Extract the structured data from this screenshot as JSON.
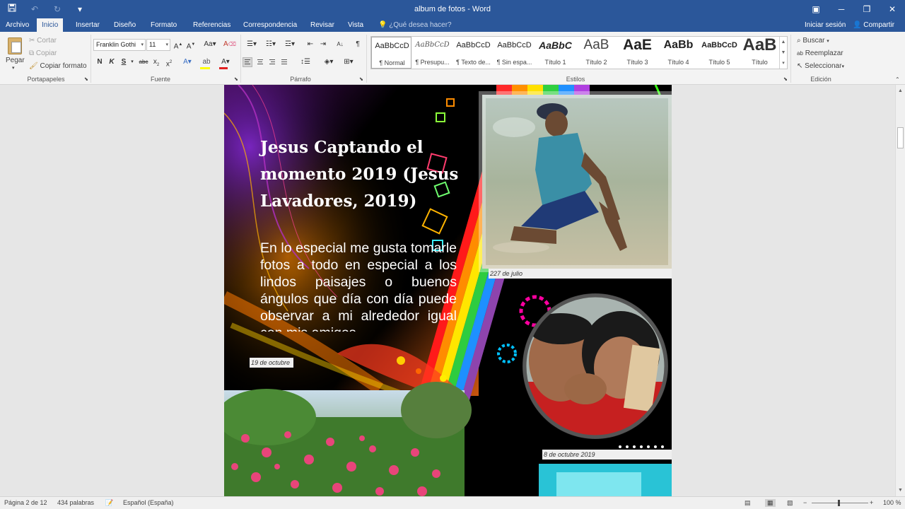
{
  "window": {
    "title": "album de fotos  -  Word",
    "controls": [
      "minimize-icon",
      "restore-icon",
      "close-icon"
    ]
  },
  "tabs": [
    {
      "label": "Archivo",
      "active": false
    },
    {
      "label": "Inicio",
      "active": true
    },
    {
      "label": "Insertar",
      "active": false
    },
    {
      "label": "Diseño",
      "active": false
    },
    {
      "label": "Formato",
      "active": false
    },
    {
      "label": "Referencias",
      "active": false
    },
    {
      "label": "Correspondencia",
      "active": false
    },
    {
      "label": "Revisar",
      "active": false
    },
    {
      "label": "Vista",
      "active": false
    }
  ],
  "tell_me": "¿Qué desea hacer?",
  "signin": "Iniciar sesión",
  "share": "Compartir",
  "clipboard": {
    "paste": "Pegar",
    "cut": "Cortar",
    "copy": "Copiar",
    "format_painter": "Copiar formato",
    "label": "Portapapeles"
  },
  "font": {
    "name": "Franklin Gothi",
    "size": "11",
    "label": "Fuente"
  },
  "paragraph": {
    "label": "Párrafo"
  },
  "styles": {
    "label": "Estilos",
    "items": [
      {
        "preview": "AaBbCcD",
        "name": "¶ Normal"
      },
      {
        "preview": "AaBbCcD",
        "name": "¶ Presupu..."
      },
      {
        "preview": "AaBbCcD",
        "name": "¶ Texto de..."
      },
      {
        "preview": "AaBbCcD",
        "name": "¶ Sin espa..."
      },
      {
        "preview": "AaBbC",
        "name": "Título 1"
      },
      {
        "preview": "AaB",
        "name": "Título 2"
      },
      {
        "preview": "AaE",
        "name": "Título 3"
      },
      {
        "preview": "AaBb",
        "name": "Título 4"
      },
      {
        "preview": "AaBbCcD",
        "name": "Título 5"
      },
      {
        "preview": "AaB",
        "name": "Título"
      }
    ]
  },
  "editing": {
    "find": "Buscar",
    "replace": "Reemplazar",
    "select": "Seleccionar",
    "label": "Edición"
  },
  "document": {
    "title": "Jesus Captando el momento 2019 (Jesus Lavadores, 2019)",
    "body": "En lo especial me gusta tomarle fotos a todo en especial a los lindos paisajes o buenos ángulos que día con día puede observar a mi alrededor igual con mis amigos",
    "captions": {
      "photo1": "227 de julio",
      "left": "19 de octubre",
      "photo2": "8 de octubre 2019"
    }
  },
  "status": {
    "page": "Página 2 de 12",
    "words": "434 palabras",
    "language": "Español (España)",
    "zoom": "100 %"
  }
}
